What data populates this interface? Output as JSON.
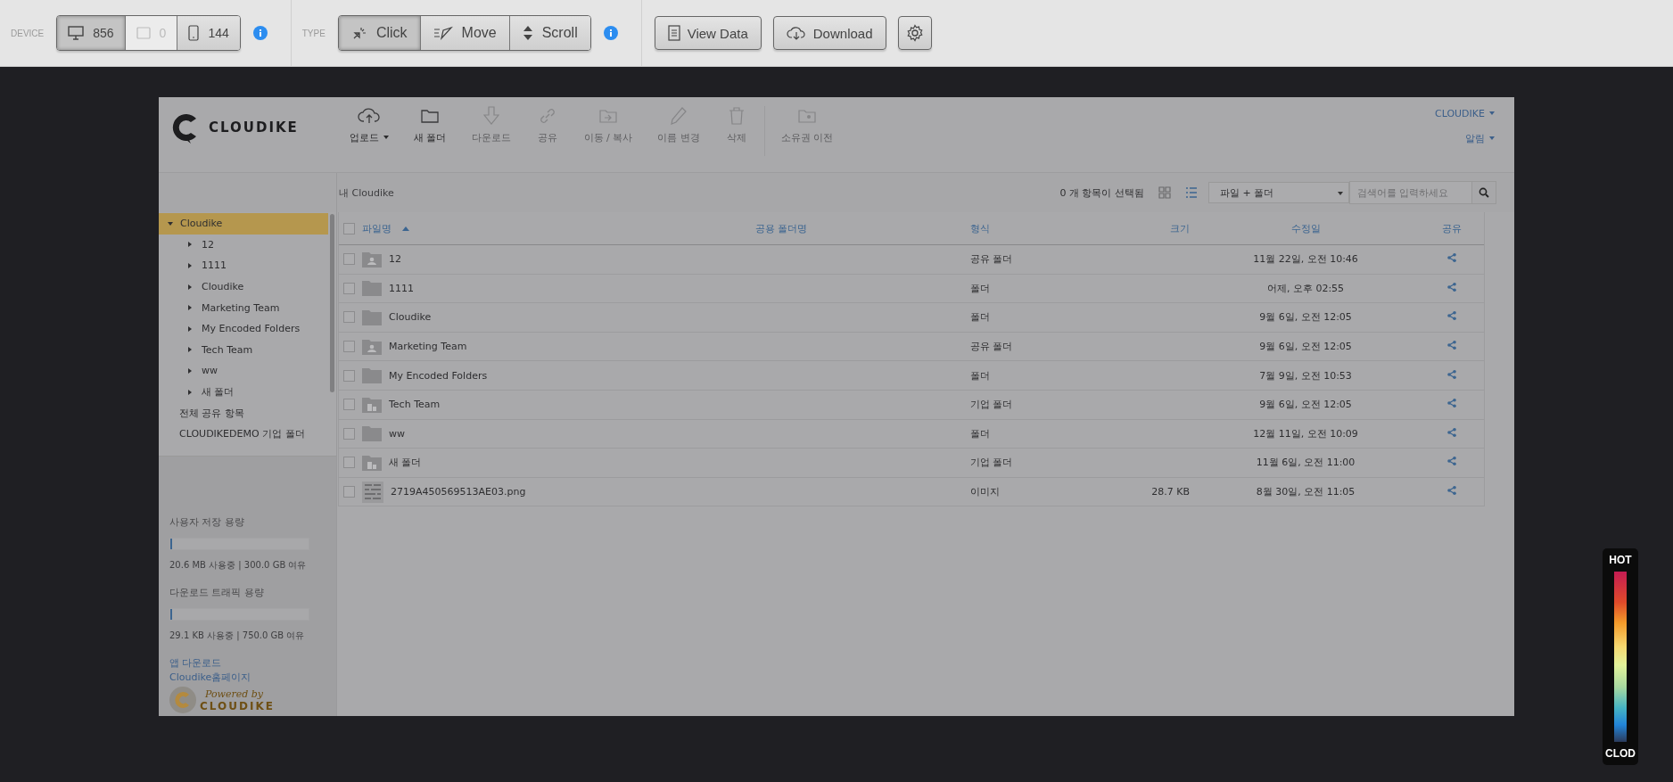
{
  "toolbar": {
    "device": {
      "label": "DEVICE",
      "buttons": [
        {
          "kind": "desktop",
          "count": "856",
          "selected": true,
          "disabled": false
        },
        {
          "kind": "tablet",
          "count": "0",
          "selected": false,
          "disabled": true
        },
        {
          "kind": "phone",
          "count": "144",
          "selected": false,
          "disabled": false
        }
      ]
    },
    "type": {
      "label": "TYPE",
      "buttons": [
        {
          "kind": "click",
          "label": "Click",
          "selected": true
        },
        {
          "kind": "move",
          "label": "Move",
          "selected": false
        },
        {
          "kind": "scroll",
          "label": "Scroll",
          "selected": false
        }
      ]
    },
    "actions": [
      {
        "kind": "data",
        "label": "View Data"
      },
      {
        "kind": "download",
        "label": "Download"
      },
      {
        "kind": "settings"
      }
    ]
  },
  "app": {
    "logo": "CLOUDIKE",
    "tools": [
      {
        "kind": "upload",
        "label": "업로드",
        "caret": true,
        "disabled": false
      },
      {
        "kind": "folder",
        "label": "새 폴더",
        "caret": false,
        "disabled": false
      },
      {
        "kind": "download",
        "label": "다운로드",
        "caret": false,
        "disabled": true
      },
      {
        "kind": "link",
        "label": "공유",
        "caret": false,
        "disabled": true
      },
      {
        "kind": "move",
        "label": "이동 / 복사",
        "caret": false,
        "disabled": true
      },
      {
        "kind": "rename",
        "label": "이름 변경",
        "caret": false,
        "disabled": true
      },
      {
        "kind": "delete",
        "label": "삭제",
        "caret": false,
        "disabled": true
      },
      {
        "kind": "transfer",
        "label": "소유권 이전",
        "caret": false,
        "disabled": true
      }
    ],
    "user_menu": [
      "CLOUDIKE",
      "알림"
    ],
    "breadcrumb": "내 Cloudike",
    "selection": "0 개 항목이 선택됨",
    "views": [
      {
        "kind": "grid",
        "selected": false
      },
      {
        "kind": "list",
        "selected": true
      }
    ],
    "filter": "파일 + 폴더",
    "search": {
      "placeholder": "검색어를 입력하세요"
    },
    "sidebar": {
      "tree": [
        {
          "label": "Cloudike",
          "expanded": true,
          "selected": true,
          "children": [
            {
              "label": "12",
              "expanded": false,
              "selected": false
            },
            {
              "label": "1111",
              "expanded": false,
              "selected": false
            },
            {
              "label": "Cloudike",
              "expanded": false,
              "selected": false
            },
            {
              "label": "Marketing Team",
              "expanded": false,
              "selected": false
            },
            {
              "label": "My Encoded Folders",
              "expanded": false,
              "selected": false
            },
            {
              "label": "Tech Team",
              "expanded": false,
              "selected": false
            },
            {
              "label": "ww",
              "expanded": false,
              "selected": false
            },
            {
              "label": "새 폴더",
              "expanded": false,
              "selected": false
            }
          ]
        }
      ],
      "items": [
        "전체 공유 항목",
        "CLOUDIKEDEMO 기업 폴더"
      ],
      "quotas": [
        {
          "title": "사용자 저장 용량",
          "level": 0.01,
          "usage": "20.6 MB 사용중 | 300.0 GB 여유"
        },
        {
          "title": "다운로드 트래픽 용량",
          "level": 0.01,
          "usage": "29.1 KB 사용중 | 750.0 GB 여유"
        }
      ],
      "links": [
        "앱 다운로드",
        "Cloudike홈페이지"
      ],
      "powered": {
        "caption": "Powered by",
        "brand": "CLOUDIKE"
      }
    },
    "table": {
      "select_all": {
        "checked": false
      },
      "columns": [
        {
          "label": "파일명",
          "sorted": true
        },
        {
          "label": "공용 폴더명",
          "sorted": false
        },
        {
          "label": "형식",
          "sorted": false
        },
        {
          "label": "크기",
          "sorted": false
        },
        {
          "label": "수정일",
          "sorted": false
        },
        {
          "label": "공유",
          "sorted": false
        }
      ],
      "rows": [
        {
          "kind": "shared",
          "name": "12",
          "type": "공유 폴더",
          "modified": "11월 22일, 오전 10:46",
          "checked": false
        },
        {
          "kind": "folder",
          "name": "1111",
          "type": "폴더",
          "modified": "어제, 오후 02:55",
          "checked": false
        },
        {
          "kind": "folder",
          "name": "Cloudike",
          "type": "폴더",
          "modified": "9월 6일, 오전 12:05",
          "checked": false
        },
        {
          "kind": "shared",
          "name": "Marketing Team",
          "type": "공유 폴더",
          "modified": "9월 6일, 오전 12:05",
          "checked": false
        },
        {
          "kind": "folder",
          "name": "My Encoded Folders",
          "type": "폴더",
          "modified": "7월 9일, 오전 10:53",
          "checked": false
        },
        {
          "kind": "corporate",
          "name": "Tech Team",
          "type": "기업 폴더",
          "modified": "9월 6일, 오전 12:05",
          "checked": false
        },
        {
          "kind": "folder",
          "name": "ww",
          "type": "폴더",
          "modified": "12월 11일, 오전 10:09",
          "checked": false
        },
        {
          "kind": "corporate",
          "name": "새 폴더",
          "type": "기업 폴더",
          "modified": "11월 6일, 오전 11:00",
          "checked": false
        },
        {
          "kind": "image",
          "name": "2719A450569513AE03.png",
          "type": "이미지",
          "size": "28.7 KB",
          "modified": "8월 30일, 오전 11:05",
          "checked": false
        }
      ]
    }
  },
  "legend": {
    "top": "HOT",
    "bottom": "CLOD"
  }
}
